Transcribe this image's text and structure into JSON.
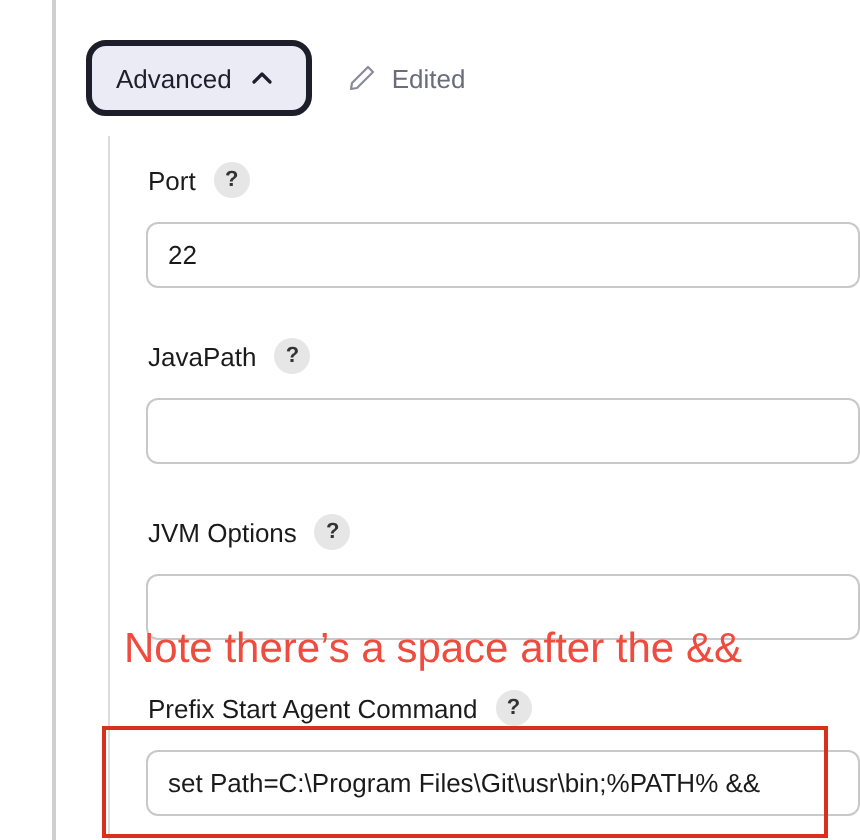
{
  "advanced_button": {
    "label": "Advanced",
    "expanded": true
  },
  "edited_status": {
    "label": "Edited"
  },
  "fields": [
    {
      "label": "Port",
      "help": "?",
      "value": "22",
      "highlighted": false
    },
    {
      "label": "JavaPath",
      "help": "?",
      "highlighted": false
    },
    {
      "label": "JVM Options",
      "help": "?",
      "highlighted": false
    },
    {
      "label": "Prefix Start Agent Command",
      "help": "?",
      "value": "set Path=C:\\Program Files\\Git\\usr\\bin;%PATH% &&",
      "highlighted": true
    }
  ],
  "annotation": {
    "note": "Note there’s a space after the &&"
  }
}
